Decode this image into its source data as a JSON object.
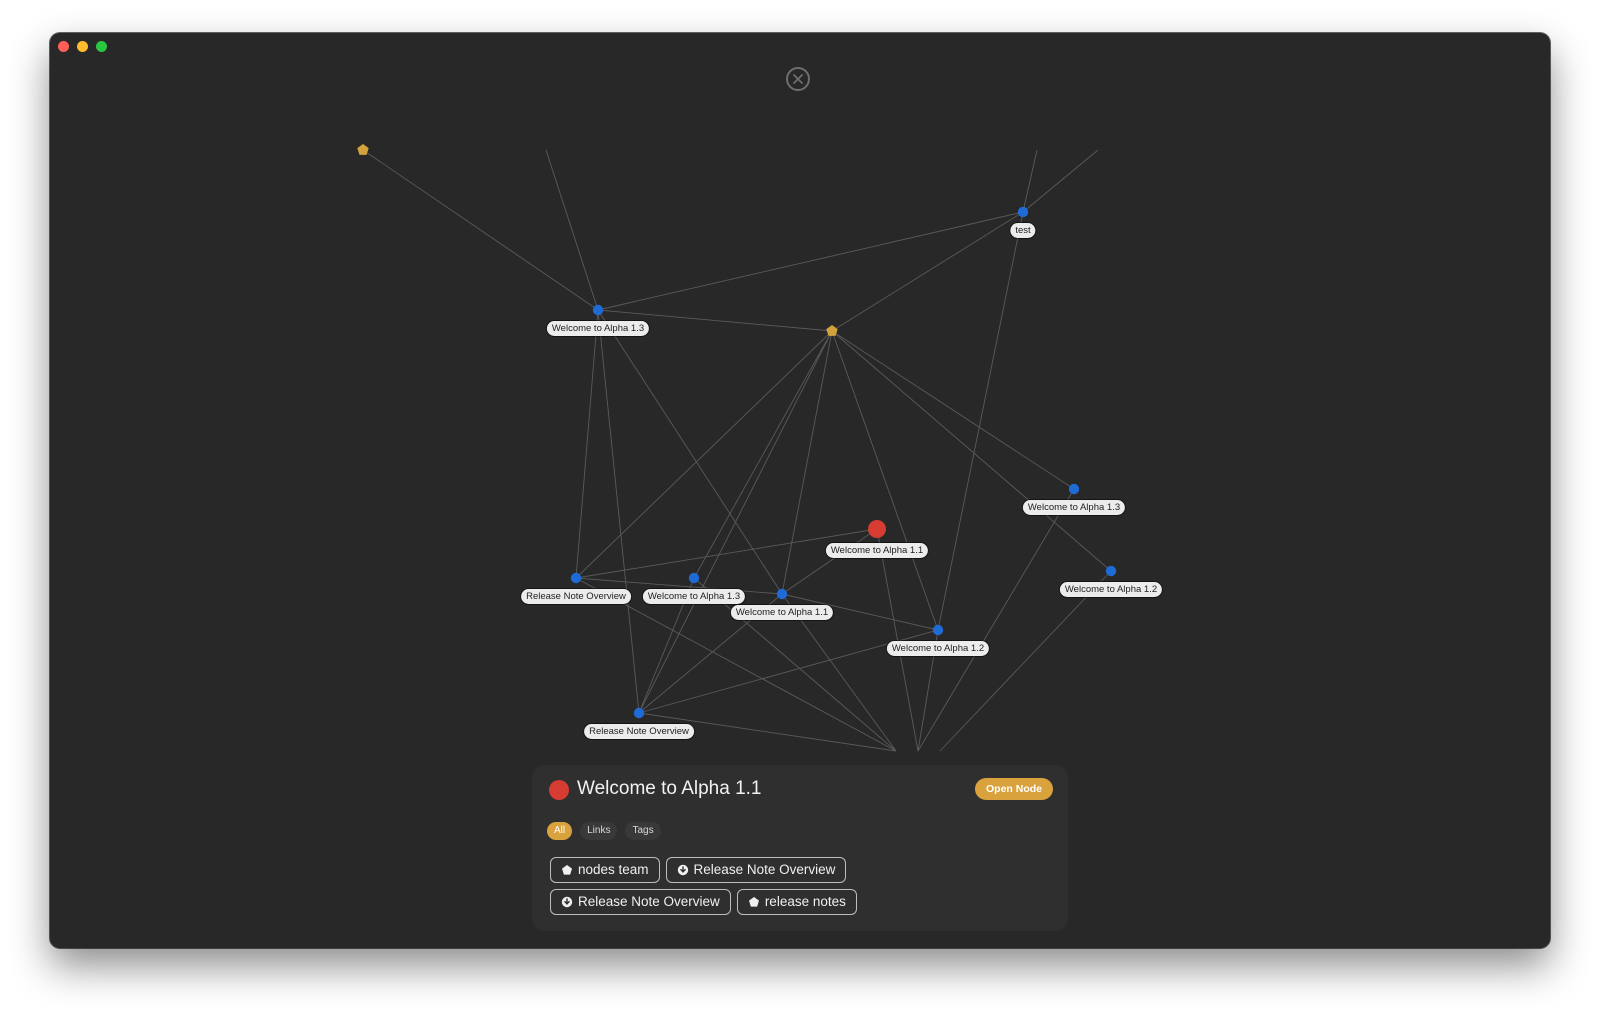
{
  "colors": {
    "window_bg": "#282828",
    "edge": "#5a5a5a",
    "note_node": "#1e6bd6",
    "tag_node": "#d4a23c",
    "selected_node": "#d63c32",
    "accent": "#d9a23c",
    "traffic_close": "#ff5f57",
    "traffic_minimize": "#febc2e",
    "traffic_zoom": "#28c840"
  },
  "graph": {
    "nodes": [
      {
        "id": "tag-top",
        "type": "tag",
        "label": ""
      },
      {
        "id": "test",
        "type": "note",
        "label": "test"
      },
      {
        "id": "a13-left",
        "type": "note",
        "label": "Welcome to Alpha 1.3"
      },
      {
        "id": "tag-center",
        "type": "tag",
        "label": ""
      },
      {
        "id": "a13-right",
        "type": "note",
        "label": "Welcome to Alpha 1.3"
      },
      {
        "id": "selected",
        "type": "selected",
        "label": "Welcome to Alpha 1.1"
      },
      {
        "id": "rno-mid",
        "type": "note",
        "label": "Release Note Overview"
      },
      {
        "id": "a13-mid",
        "type": "note",
        "label": "Welcome to Alpha 1.3"
      },
      {
        "id": "a11-mid",
        "type": "note",
        "label": "Welcome to Alpha 1.1"
      },
      {
        "id": "a12-right",
        "type": "note",
        "label": "Welcome to Alpha 1.2"
      },
      {
        "id": "a12-mid",
        "type": "note",
        "label": "Welcome to Alpha 1.2"
      },
      {
        "id": "rno-low",
        "type": "note",
        "label": "Release Note Overview"
      }
    ],
    "edges": [
      [
        "tag-top",
        "a13-left"
      ],
      [
        "top-a",
        "a13-left"
      ],
      [
        "a13-left",
        "test"
      ],
      [
        "a13-left",
        "tag-center"
      ],
      [
        "tag-center",
        "test"
      ],
      [
        "test",
        "top-b"
      ],
      [
        "test",
        "top-c"
      ],
      [
        "test",
        "a12-mid"
      ],
      [
        "a13-left",
        "rno-mid"
      ],
      [
        "a13-left",
        "rno-low"
      ],
      [
        "a13-left",
        "a11-mid"
      ],
      [
        "tag-center",
        "rno-mid"
      ],
      [
        "tag-center",
        "a13-mid"
      ],
      [
        "tag-center",
        "rno-low"
      ],
      [
        "tag-center",
        "a11-mid"
      ],
      [
        "tag-center",
        "a12-mid"
      ],
      [
        "tag-center",
        "a13-right"
      ],
      [
        "tag-center",
        "a12-right"
      ],
      [
        "rno-mid",
        "selected"
      ],
      [
        "rno-mid",
        "a11-mid"
      ],
      [
        "selected",
        "a11-mid"
      ],
      [
        "a11-mid",
        "a12-mid"
      ],
      [
        "a13-mid",
        "rno-low"
      ],
      [
        "rno-low",
        "a11-mid"
      ],
      [
        "rno-low",
        "a12-mid"
      ],
      [
        "a13-right",
        "bottom-b"
      ],
      [
        "a12-right",
        "bottom-c"
      ],
      [
        "rno-low",
        "bottom-a"
      ],
      [
        "rno-mid",
        "bottom-a"
      ],
      [
        "a11-mid",
        "bottom-a"
      ],
      [
        "a13-mid",
        "bottom-a"
      ],
      [
        "selected",
        "bottom-b"
      ],
      [
        "a12-mid",
        "bottom-b"
      ]
    ]
  },
  "panel": {
    "title": "Welcome to Alpha 1.1",
    "open_button": "Open Node",
    "filters": [
      {
        "label": "All",
        "active": true
      },
      {
        "label": "Links",
        "active": false
      },
      {
        "label": "Tags",
        "active": false
      }
    ],
    "links": [
      {
        "label": "nodes team",
        "icon": "tag-pentagon-icon"
      },
      {
        "label": "Release Note Overview",
        "icon": "note-download-icon"
      },
      {
        "label": "Release Note Overview",
        "icon": "note-download-icon"
      },
      {
        "label": "release notes",
        "icon": "tag-pentagon-icon"
      }
    ]
  }
}
